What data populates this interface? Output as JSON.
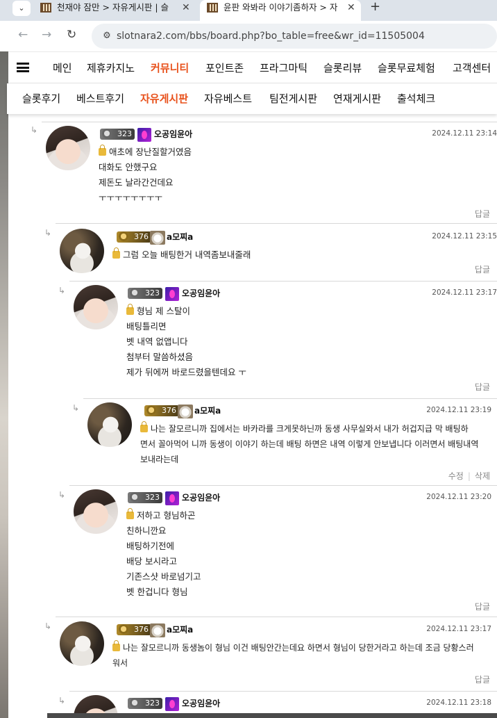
{
  "browser": {
    "tabs": [
      {
        "title": "천재야 잠만 > 자유게시판 | 슬",
        "close": "✕"
      },
      {
        "title": "윤판 와봐라 이야기좀하자 > 자",
        "close": "✕"
      }
    ],
    "new_tab": "+",
    "url": "slotnara2.com/bbs/board.php?bo_table=free&wr_id=11505004"
  },
  "site": {
    "main_menu": [
      "메인",
      "제휴카지노",
      "커뮤니티",
      "포인트존",
      "프라그마틱",
      "슬롯리뷰",
      "슬롯무료체험",
      "고객센터"
    ],
    "main_active": "커뮤니티",
    "sub_menu": [
      "슬롯후기",
      "베스트후기",
      "자유게시판",
      "자유베스트",
      "팀전게시판",
      "연재게시판",
      "출석체크"
    ],
    "sub_active": "자유게시판",
    "accent_color": "#e8501a"
  },
  "comments": [
    {
      "level": "323",
      "nickname": "오공임윤아",
      "date": "2024.12.11 23:14",
      "lines": [
        "애초에 장난질할거였음",
        "대화도 안했구요",
        "제돈도 날라간건데요",
        "ㅜㅜㅜㅜㅜㅜㅜㅜ"
      ],
      "actions": [
        "답글"
      ]
    },
    {
      "level": "376",
      "nickname": "a모찌a",
      "date": "2024.12.11 23:15",
      "lines": [
        "그럼 오늘 배팅한거 내역좀보내줄래"
      ],
      "actions": [
        "답글"
      ]
    },
    {
      "level": "323",
      "nickname": "오공임윤아",
      "date": "2024.12.11 23:17",
      "lines": [
        "형님 제 스탈이",
        "배팅틀리면",
        "벳 내역 없앱니다",
        "첨부터 말씀하셨음",
        "제가 뒤에꺼 바로드렸을텐데요 ㅜ"
      ],
      "actions": [
        "답글"
      ]
    },
    {
      "level": "376",
      "nickname": "a모찌a",
      "date": "2024.12.11 23:19",
      "lines": [
        "나는 잘모르니까 집에서는 바카라를 크게못하닌까  동생 사무실와서 내가 허겁지급 막 배팅하",
        "면서 꼴아먹어 니까 동생이 이야기 하는데 배팅 하면은 내역 이렇게 안보냅니다 이러면서 배팅내역",
        "보내라는데"
      ],
      "actions": [
        "수정",
        "삭제"
      ]
    },
    {
      "level": "323",
      "nickname": "오공임윤아",
      "date": "2024.12.11 23:20",
      "lines": [
        "저하고 형님하곤",
        "친하니깐요",
        "배팅하기전에",
        "배당 보시라고",
        "기존스샷 바로넘기고",
        "벳 한겁니다 형님"
      ],
      "actions": [
        "답글"
      ]
    },
    {
      "level": "376",
      "nickname": "a모찌a",
      "date": "2024.12.11 23:17",
      "lines": [
        "나는 잘모르니까 동생놈이 형님 이건 배팅안간는데요 하면서 형님이 당한거라고 하는데 조금 당황스러",
        "워서"
      ],
      "actions": [
        "답글"
      ]
    },
    {
      "level": "323",
      "nickname": "오공임윤아",
      "date": "2024.12.11 23:18",
      "lines": [],
      "actions": []
    }
  ]
}
